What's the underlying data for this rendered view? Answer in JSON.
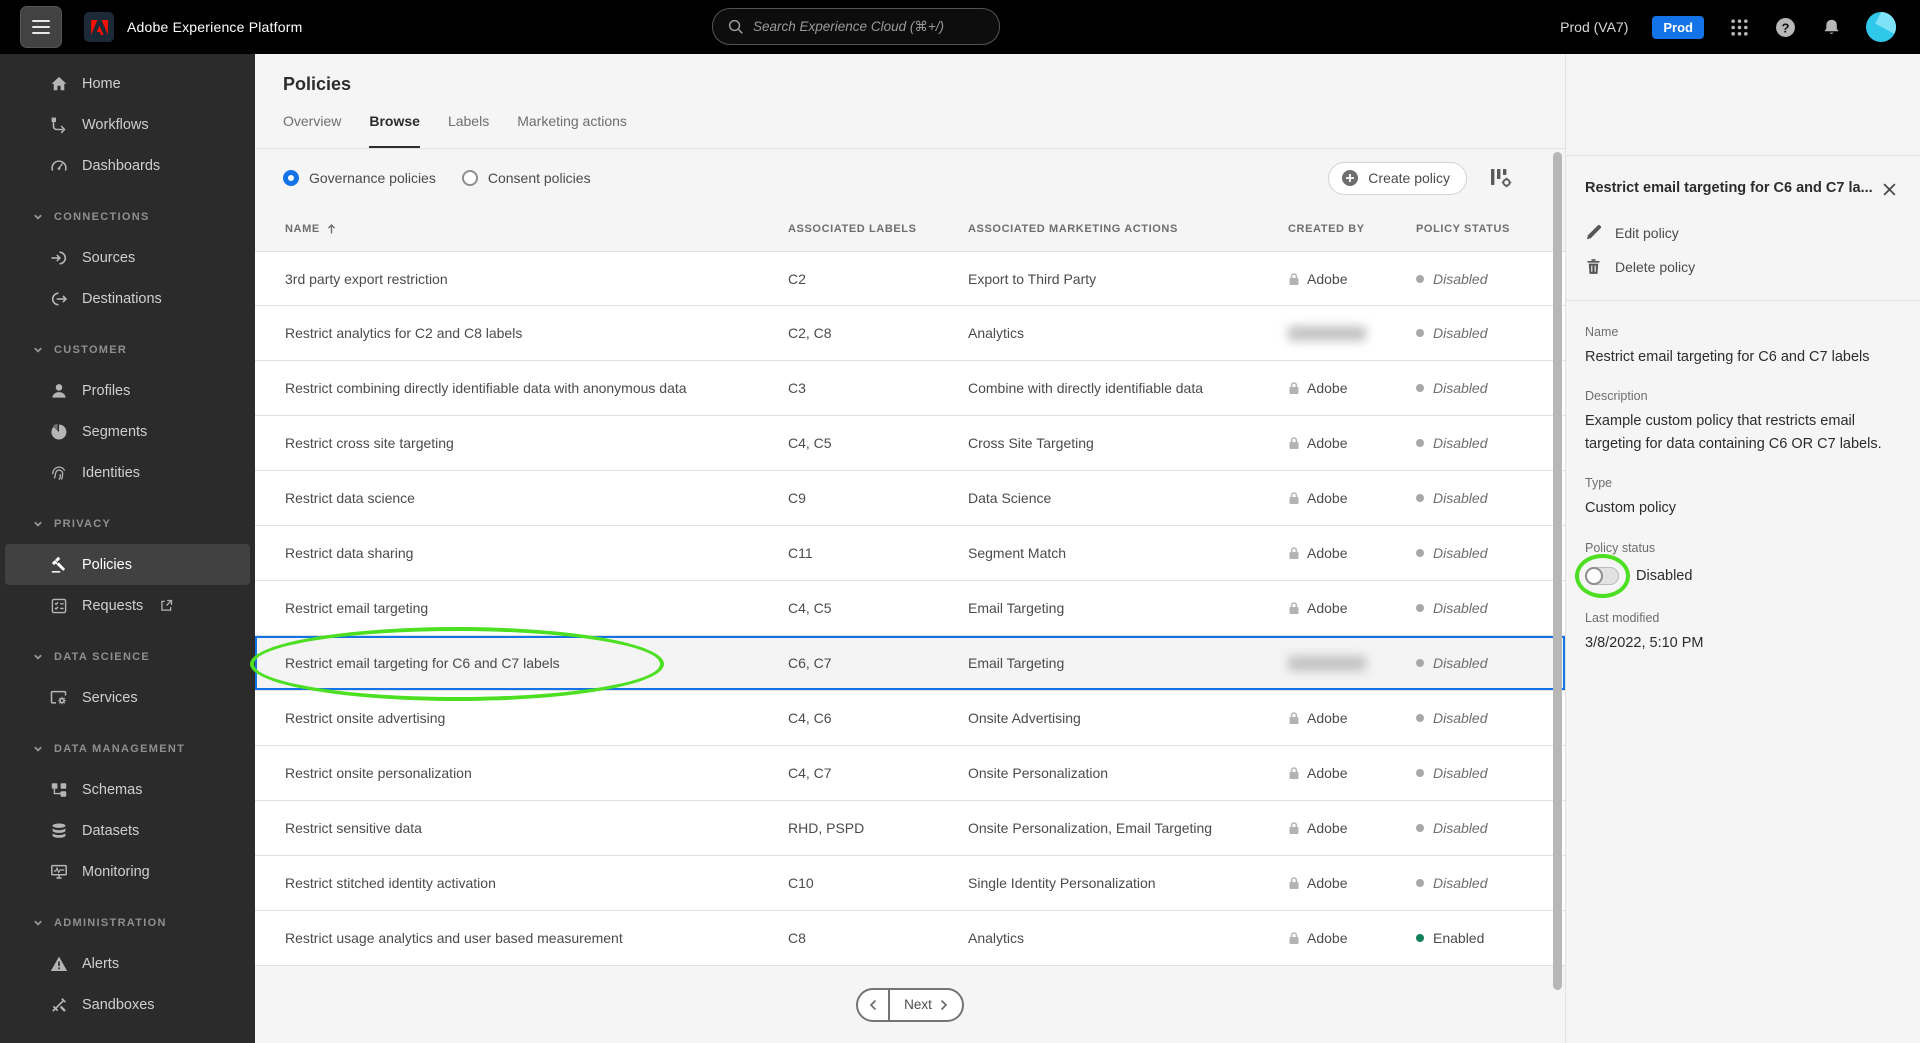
{
  "header": {
    "app_title": "Adobe Experience Platform",
    "search_placeholder": "Search Experience Cloud (⌘+/)",
    "environment": "Prod (VA7)",
    "env_badge": "Prod"
  },
  "sidebar": {
    "items": [
      {
        "type": "item",
        "label": "Home",
        "icon": "home"
      },
      {
        "type": "item",
        "label": "Workflows",
        "icon": "workflows"
      },
      {
        "type": "item",
        "label": "Dashboards",
        "icon": "dashboards"
      },
      {
        "type": "section",
        "label": "CONNECTIONS"
      },
      {
        "type": "item",
        "label": "Sources",
        "icon": "sources"
      },
      {
        "type": "item",
        "label": "Destinations",
        "icon": "destinations"
      },
      {
        "type": "section",
        "label": "CUSTOMER"
      },
      {
        "type": "item",
        "label": "Profiles",
        "icon": "profiles"
      },
      {
        "type": "item",
        "label": "Segments",
        "icon": "segments"
      },
      {
        "type": "item",
        "label": "Identities",
        "icon": "identities"
      },
      {
        "type": "section",
        "label": "PRIVACY"
      },
      {
        "type": "item",
        "label": "Policies",
        "icon": "policies",
        "selected": true
      },
      {
        "type": "item",
        "label": "Requests",
        "icon": "requests",
        "external": true
      },
      {
        "type": "section",
        "label": "DATA SCIENCE"
      },
      {
        "type": "item",
        "label": "Services",
        "icon": "services"
      },
      {
        "type": "section",
        "label": "DATA MANAGEMENT"
      },
      {
        "type": "item",
        "label": "Schemas",
        "icon": "schemas"
      },
      {
        "type": "item",
        "label": "Datasets",
        "icon": "datasets"
      },
      {
        "type": "item",
        "label": "Monitoring",
        "icon": "monitoring"
      },
      {
        "type": "section",
        "label": "ADMINISTRATION"
      },
      {
        "type": "item",
        "label": "Alerts",
        "icon": "alerts"
      },
      {
        "type": "item",
        "label": "Sandboxes",
        "icon": "sandboxes"
      }
    ]
  },
  "main": {
    "page_title": "Policies",
    "tabs": [
      {
        "label": "Overview",
        "active": false
      },
      {
        "label": "Browse",
        "active": true
      },
      {
        "label": "Labels",
        "active": false
      },
      {
        "label": "Marketing actions",
        "active": false
      }
    ],
    "radios": [
      {
        "label": "Governance policies",
        "selected": true
      },
      {
        "label": "Consent policies",
        "selected": false
      }
    ],
    "create_button_label": "Create policy",
    "table": {
      "columns": [
        "NAME",
        "ASSOCIATED LABELS",
        "ASSOCIATED MARKETING ACTIONS",
        "CREATED BY",
        "POLICY STATUS"
      ],
      "rows": [
        {
          "name": "3rd party export restriction",
          "labels": "C2",
          "actions": "Export to Third Party",
          "created_by": "Adobe",
          "locked": true,
          "redacted": false,
          "status": "Disabled",
          "selected": false,
          "annotated": false
        },
        {
          "name": "Restrict analytics for C2 and C8 labels",
          "labels": "C2, C8",
          "actions": "Analytics",
          "created_by": "",
          "locked": false,
          "redacted": true,
          "status": "Disabled",
          "selected": false,
          "annotated": false
        },
        {
          "name": "Restrict combining directly identifiable data with anonymous data",
          "labels": "C3",
          "actions": "Combine with directly identifiable data",
          "created_by": "Adobe",
          "locked": true,
          "redacted": false,
          "status": "Disabled",
          "selected": false,
          "annotated": false
        },
        {
          "name": "Restrict cross site targeting",
          "labels": "C4, C5",
          "actions": "Cross Site Targeting",
          "created_by": "Adobe",
          "locked": true,
          "redacted": false,
          "status": "Disabled",
          "selected": false,
          "annotated": false
        },
        {
          "name": "Restrict data science",
          "labels": "C9",
          "actions": "Data Science",
          "created_by": "Adobe",
          "locked": true,
          "redacted": false,
          "status": "Disabled",
          "selected": false,
          "annotated": false
        },
        {
          "name": "Restrict data sharing",
          "labels": "C11",
          "actions": "Segment Match",
          "created_by": "Adobe",
          "locked": true,
          "redacted": false,
          "status": "Disabled",
          "selected": false,
          "annotated": false
        },
        {
          "name": "Restrict email targeting",
          "labels": "C4, C5",
          "actions": "Email Targeting",
          "created_by": "Adobe",
          "locked": true,
          "redacted": false,
          "status": "Disabled",
          "selected": false,
          "annotated": false
        },
        {
          "name": "Restrict email targeting for C6 and C7 labels",
          "labels": "C6, C7",
          "actions": "Email Targeting",
          "created_by": "",
          "locked": false,
          "redacted": true,
          "status": "Disabled",
          "selected": true,
          "annotated": true
        },
        {
          "name": "Restrict onsite advertising",
          "labels": "C4, C6",
          "actions": "Onsite Advertising",
          "created_by": "Adobe",
          "locked": true,
          "redacted": false,
          "status": "Disabled",
          "selected": false,
          "annotated": false
        },
        {
          "name": "Restrict onsite personalization",
          "labels": "C4, C7",
          "actions": "Onsite Personalization",
          "created_by": "Adobe",
          "locked": true,
          "redacted": false,
          "status": "Disabled",
          "selected": false,
          "annotated": false
        },
        {
          "name": "Restrict sensitive data",
          "labels": "RHD, PSPD",
          "actions": "Onsite Personalization, Email Targeting",
          "created_by": "Adobe",
          "locked": true,
          "redacted": false,
          "status": "Disabled",
          "selected": false,
          "annotated": false
        },
        {
          "name": "Restrict stitched identity activation",
          "labels": "C10",
          "actions": "Single Identity Personalization",
          "created_by": "Adobe",
          "locked": true,
          "redacted": false,
          "status": "Disabled",
          "selected": false,
          "annotated": false
        },
        {
          "name": "Restrict usage analytics and user based measurement",
          "labels": "C8",
          "actions": "Analytics",
          "created_by": "Adobe",
          "locked": true,
          "redacted": false,
          "status": "Enabled",
          "selected": false,
          "annotated": false
        }
      ]
    },
    "pagination": {
      "next_label": "Next"
    }
  },
  "panel": {
    "title": "Restrict email targeting for C6 and C7 la...",
    "actions": [
      {
        "label": "Edit policy",
        "icon": "pencil"
      },
      {
        "label": "Delete policy",
        "icon": "trash"
      }
    ],
    "fields": {
      "name": {
        "label": "Name",
        "value": "Restrict email targeting for C6 and C7 labels"
      },
      "description": {
        "label": "Description",
        "value": "Example custom policy that restricts email targeting for data containing C6 OR C7 labels."
      },
      "type": {
        "label": "Type",
        "value": "Custom policy"
      },
      "policy_status": {
        "label": "Policy status",
        "value": "Disabled",
        "toggle_on": false
      },
      "last_modified": {
        "label": "Last modified",
        "value": "3/8/2022, 5:10 PM"
      }
    }
  },
  "colors": {
    "accent_blue": "#1473e6",
    "annotation_green": "#4ddf21",
    "enabled_green": "#12805c",
    "disabled_gray": "#a8a8a8",
    "env_badge_blue": "#1473e6",
    "avatar_cyan": "#2fc7ea"
  }
}
